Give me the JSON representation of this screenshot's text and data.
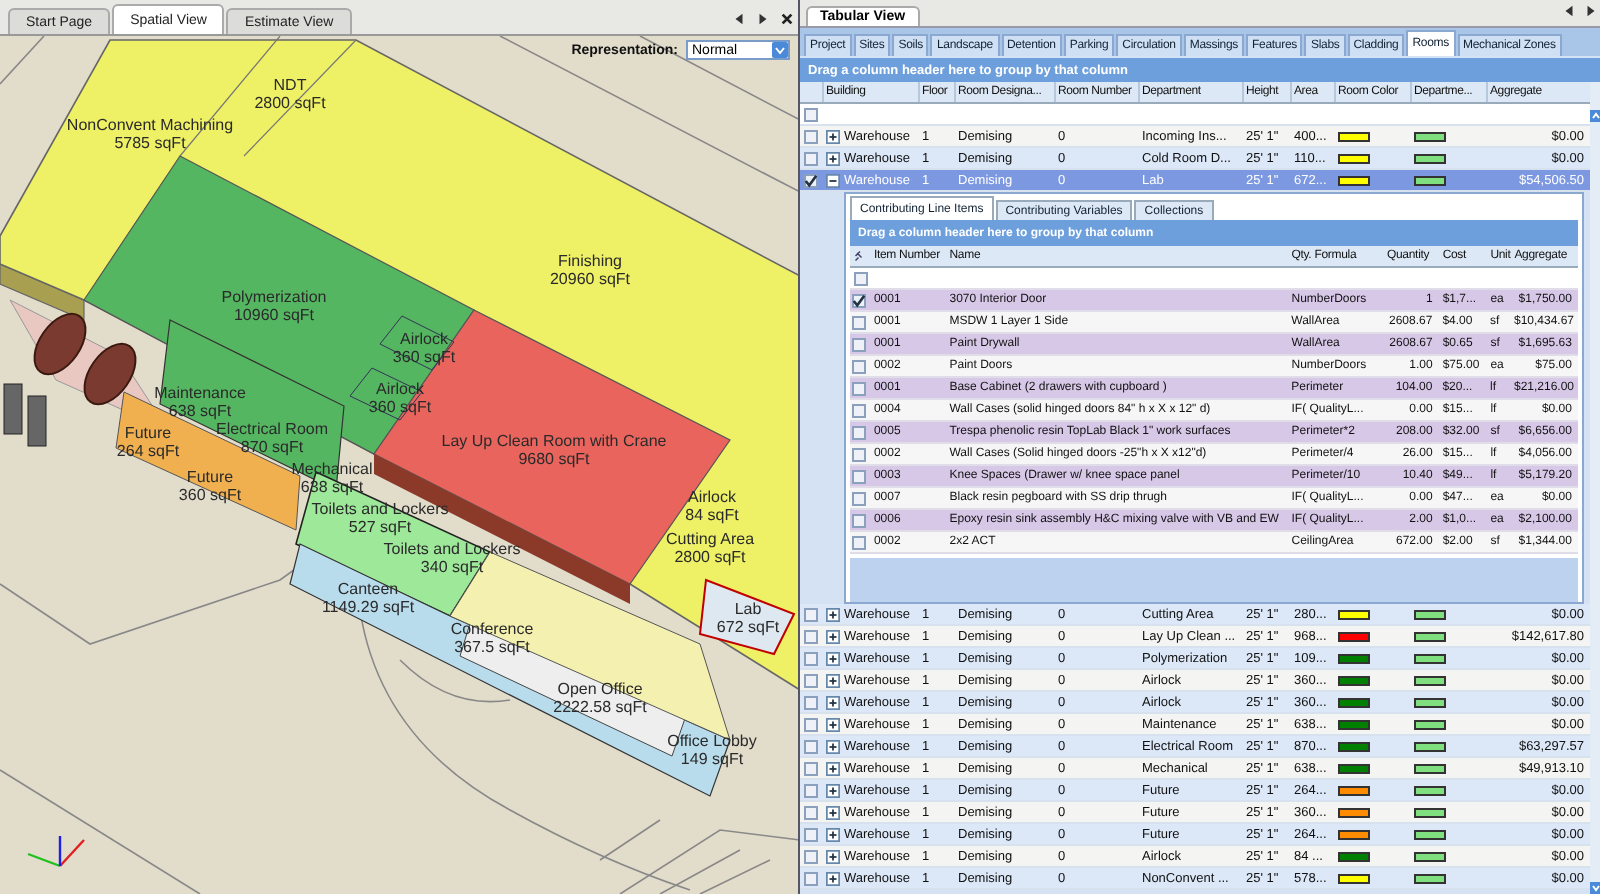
{
  "spatial_panel": {
    "tabs": [
      {
        "label": "Start Page",
        "selected": false
      },
      {
        "label": "Spatial View",
        "selected": true
      },
      {
        "label": "Estimate View",
        "selected": false
      }
    ],
    "representation": {
      "label": "Representation:",
      "value": "Normal"
    },
    "rooms": [
      {
        "name": "NonConvent Machining",
        "area": "5785 sqFt"
      },
      {
        "name": "NDT",
        "area": "2800 sqFt"
      },
      {
        "name": "Finishing",
        "area": "20960 sqFt"
      },
      {
        "name": "Polymerization",
        "area": "10960 sqFt"
      },
      {
        "name": "Airlock",
        "area": "360 sqFt"
      },
      {
        "name": "Airlock",
        "area": "360 sqFt"
      },
      {
        "name": "Lay Up Clean Room with Crane",
        "area": "9680 sqFt"
      },
      {
        "name": "Maintenance",
        "area": "638 sqFt"
      },
      {
        "name": "Future",
        "area": "264 sqFt"
      },
      {
        "name": "Electrical Room",
        "area": "870 sqFt"
      },
      {
        "name": "Mechanical",
        "area": "638 sqFt"
      },
      {
        "name": "Future",
        "area": "360 sqFt"
      },
      {
        "name": "Toilets and Lockers",
        "area": "527 sqFt"
      },
      {
        "name": "Toilets and Lockers",
        "area": "340 sqFt"
      },
      {
        "name": "Canteen",
        "area": "1149.29 sqFt"
      },
      {
        "name": "Conference",
        "area": "367.5 sqFt"
      },
      {
        "name": "Open Office",
        "area": "2222.58 sqFt"
      },
      {
        "name": "Airlock",
        "area": "84 sqFt"
      },
      {
        "name": "Cutting Area",
        "area": "2800 sqFt"
      },
      {
        "name": "Lab",
        "area": "672 sqFt"
      },
      {
        "name": "Office Lobby",
        "area": "149 sqFt"
      }
    ]
  },
  "tabular_panel": {
    "title": "Tabular View",
    "tabs": [
      {
        "label": "Project",
        "selected": false
      },
      {
        "label": "Sites",
        "selected": false
      },
      {
        "label": "Soils",
        "selected": false
      },
      {
        "label": "Landscape",
        "selected": false
      },
      {
        "label": "Detention",
        "selected": false
      },
      {
        "label": "Parking",
        "selected": false
      },
      {
        "label": "Circulation",
        "selected": false
      },
      {
        "label": "Massings",
        "selected": false
      },
      {
        "label": "Features",
        "selected": false
      },
      {
        "label": "Slabs",
        "selected": false
      },
      {
        "label": "Cladding",
        "selected": false
      },
      {
        "label": "Rooms",
        "selected": true
      },
      {
        "label": "Mechanical Zones",
        "selected": false
      }
    ],
    "group_hint": "Drag a column header here to group by that column",
    "filter_row": {
      "checked": false
    },
    "columns": [
      "Building",
      "Floor",
      "Room Designa...",
      "Room Number",
      "Department",
      "Height",
      "Area",
      "Room Color",
      "Departme...",
      "Aggregate"
    ],
    "rows": [
      {
        "checked": false,
        "selected": false,
        "expanded": false,
        "building": "Warehouse",
        "floor": "1",
        "designation": "Demising",
        "number": "0",
        "department": "Incoming Ins...",
        "height": "25' 1\"",
        "area": "400...",
        "color": "#ffff00",
        "aggregate": "$0.00"
      },
      {
        "checked": false,
        "selected": false,
        "expanded": false,
        "building": "Warehouse",
        "floor": "1",
        "designation": "Demising",
        "number": "0",
        "department": "Cold Room D...",
        "height": "25' 1\"",
        "area": "110...",
        "color": "#ffff00",
        "aggregate": "$0.00"
      },
      {
        "checked": true,
        "selected": true,
        "expanded": true,
        "building": "Warehouse",
        "floor": "1",
        "designation": "Demising",
        "number": "0",
        "department": "Lab",
        "height": "25' 1\"",
        "area": "672...",
        "color": "#ffff00",
        "aggregate": "$54,506.50",
        "detail": {
          "tabs": [
            {
              "label": "Contributing Line Items",
              "selected": true
            },
            {
              "label": "Contributing Variables",
              "selected": false
            },
            {
              "label": "Collections",
              "selected": false
            }
          ],
          "group_hint": "Drag a column header here to group by that column",
          "filter_row": {
            "checked": false
          },
          "columns": [
            "Item Number",
            "Name",
            "Qty. Formula",
            "Quantity",
            "Cost",
            "Unit",
            "Aggregate"
          ],
          "rows": [
            {
              "checked": true,
              "item_number": "0001",
              "name": "3070 Interior Door",
              "formula": "NumberDoors",
              "quantity": "1",
              "cost": "$1,7...",
              "unit": "ea",
              "aggregate": "$1,750.00"
            },
            {
              "checked": false,
              "item_number": "0001",
              "name": "MSDW 1 Layer 1 Side",
              "formula": "WallArea",
              "quantity": "2608.67",
              "cost": "$4.00",
              "unit": "sf",
              "aggregate": "$10,434.67"
            },
            {
              "checked": false,
              "item_number": "0001",
              "name": "Paint Drywall",
              "formula": "WallArea",
              "quantity": "2608.67",
              "cost": "$0.65",
              "unit": "sf",
              "aggregate": "$1,695.63"
            },
            {
              "checked": false,
              "item_number": "0002",
              "name": "Paint Doors",
              "formula": "NumberDoors",
              "quantity": "1.00",
              "cost": "$75.00",
              "unit": "ea",
              "aggregate": "$75.00"
            },
            {
              "checked": false,
              "item_number": "0001",
              "name": "Base Cabinet (2 drawers with cupboard )",
              "formula": "Perimeter",
              "quantity": "104.00",
              "cost": "$20...",
              "unit": "lf",
              "aggregate": "$21,216.00"
            },
            {
              "checked": false,
              "item_number": "0004",
              "name": "Wall Cases (solid hinged doors 84\" h x X x 12\" d)",
              "formula": "IF( QualityL...",
              "quantity": "0.00",
              "cost": "$15...",
              "unit": "lf",
              "aggregate": "$0.00"
            },
            {
              "checked": false,
              "item_number": "0005",
              "name": "Trespa phenolic resin TopLab Black 1\" work surfaces",
              "formula": "Perimeter*2",
              "quantity": "208.00",
              "cost": "$32.00",
              "unit": "sf",
              "aggregate": "$6,656.00"
            },
            {
              "checked": false,
              "item_number": "0002",
              "name": "Wall Cases (Solid hinged doors -25\"h x X x12\"d)",
              "formula": "Perimeter/4",
              "quantity": "26.00",
              "cost": "$15...",
              "unit": "lf",
              "aggregate": "$4,056.00"
            },
            {
              "checked": false,
              "item_number": "0003",
              "name": "Knee Spaces (Drawer w/ knee space panel",
              "formula": "Perimeter/10",
              "quantity": "10.40",
              "cost": "$49...",
              "unit": "lf",
              "aggregate": "$5,179.20"
            },
            {
              "checked": false,
              "item_number": "0007",
              "name": "Black resin pegboard with SS drip thrugh",
              "formula": "IF( QualityL...",
              "quantity": "0.00",
              "cost": "$47...",
              "unit": "ea",
              "aggregate": "$0.00"
            },
            {
              "checked": false,
              "item_number": "0006",
              "name": "Epoxy resin sink assembly H&C mixing valve with VB and EW",
              "formula": "IF( QualityL...",
              "quantity": "2.00",
              "cost": "$1,0...",
              "unit": "ea",
              "aggregate": "$2,100.00"
            },
            {
              "checked": false,
              "item_number": "0002",
              "name": "2x2 ACT",
              "formula": "CeilingArea",
              "quantity": "672.00",
              "cost": "$2.00",
              "unit": "sf",
              "aggregate": "$1,344.00"
            }
          ]
        }
      },
      {
        "checked": false,
        "selected": false,
        "expanded": false,
        "building": "Warehouse",
        "floor": "1",
        "designation": "Demising",
        "number": "0",
        "department": "Cutting Area",
        "height": "25' 1\"",
        "area": "280...",
        "color": "#ffff00",
        "aggregate": "$0.00"
      },
      {
        "checked": false,
        "selected": false,
        "expanded": false,
        "building": "Warehouse",
        "floor": "1",
        "designation": "Demising",
        "number": "0",
        "department": "Lay Up Clean ...",
        "height": "25' 1\"",
        "area": "968...",
        "color": "#ff0000",
        "aggregate": "$142,617.80"
      },
      {
        "checked": false,
        "selected": false,
        "expanded": false,
        "building": "Warehouse",
        "floor": "1",
        "designation": "Demising",
        "number": "0",
        "department": "Polymerization",
        "height": "25' 1\"",
        "area": "109...",
        "color": "#008000",
        "aggregate": "$0.00"
      },
      {
        "checked": false,
        "selected": false,
        "expanded": false,
        "building": "Warehouse",
        "floor": "1",
        "designation": "Demising",
        "number": "0",
        "department": "Airlock",
        "height": "25' 1\"",
        "area": "360...",
        "color": "#008000",
        "aggregate": "$0.00"
      },
      {
        "checked": false,
        "selected": false,
        "expanded": false,
        "building": "Warehouse",
        "floor": "1",
        "designation": "Demising",
        "number": "0",
        "department": "Airlock",
        "height": "25' 1\"",
        "area": "360...",
        "color": "#008000",
        "aggregate": "$0.00"
      },
      {
        "checked": false,
        "selected": false,
        "expanded": false,
        "building": "Warehouse",
        "floor": "1",
        "designation": "Demising",
        "number": "0",
        "department": "Maintenance",
        "height": "25' 1\"",
        "area": "638...",
        "color": "#008000",
        "aggregate": "$0.00"
      },
      {
        "checked": false,
        "selected": false,
        "expanded": false,
        "building": "Warehouse",
        "floor": "1",
        "designation": "Demising",
        "number": "0",
        "department": "Electrical Room",
        "height": "25' 1\"",
        "area": "870...",
        "color": "#008000",
        "aggregate": "$63,297.57"
      },
      {
        "checked": false,
        "selected": false,
        "expanded": false,
        "building": "Warehouse",
        "floor": "1",
        "designation": "Demising",
        "number": "0",
        "department": "Mechanical",
        "height": "25' 1\"",
        "area": "638...",
        "color": "#008000",
        "aggregate": "$49,913.10"
      },
      {
        "checked": false,
        "selected": false,
        "expanded": false,
        "building": "Warehouse",
        "floor": "1",
        "designation": "Demising",
        "number": "0",
        "department": "Future",
        "height": "25' 1\"",
        "area": "264...",
        "color": "#ff8c00",
        "aggregate": "$0.00"
      },
      {
        "checked": false,
        "selected": false,
        "expanded": false,
        "building": "Warehouse",
        "floor": "1",
        "designation": "Demising",
        "number": "0",
        "department": "Future",
        "height": "25' 1\"",
        "area": "360...",
        "color": "#ff8c00",
        "aggregate": "$0.00"
      },
      {
        "checked": false,
        "selected": false,
        "expanded": false,
        "building": "Warehouse",
        "floor": "1",
        "designation": "Demising",
        "number": "0",
        "department": "Future",
        "height": "25' 1\"",
        "area": "264...",
        "color": "#ff8c00",
        "aggregate": "$0.00"
      },
      {
        "checked": false,
        "selected": false,
        "expanded": false,
        "building": "Warehouse",
        "floor": "1",
        "designation": "Demising",
        "number": "0",
        "department": "Airlock",
        "height": "25' 1\"",
        "area": "84 ...",
        "color": "#008000",
        "aggregate": "$0.00"
      },
      {
        "checked": false,
        "selected": false,
        "expanded": false,
        "building": "Warehouse",
        "floor": "1",
        "designation": "Demising",
        "number": "0",
        "department": "NonConvent ...",
        "height": "25' 1\"",
        "area": "578...",
        "color": "#ffff00",
        "aggregate": "$0.00"
      }
    ]
  }
}
